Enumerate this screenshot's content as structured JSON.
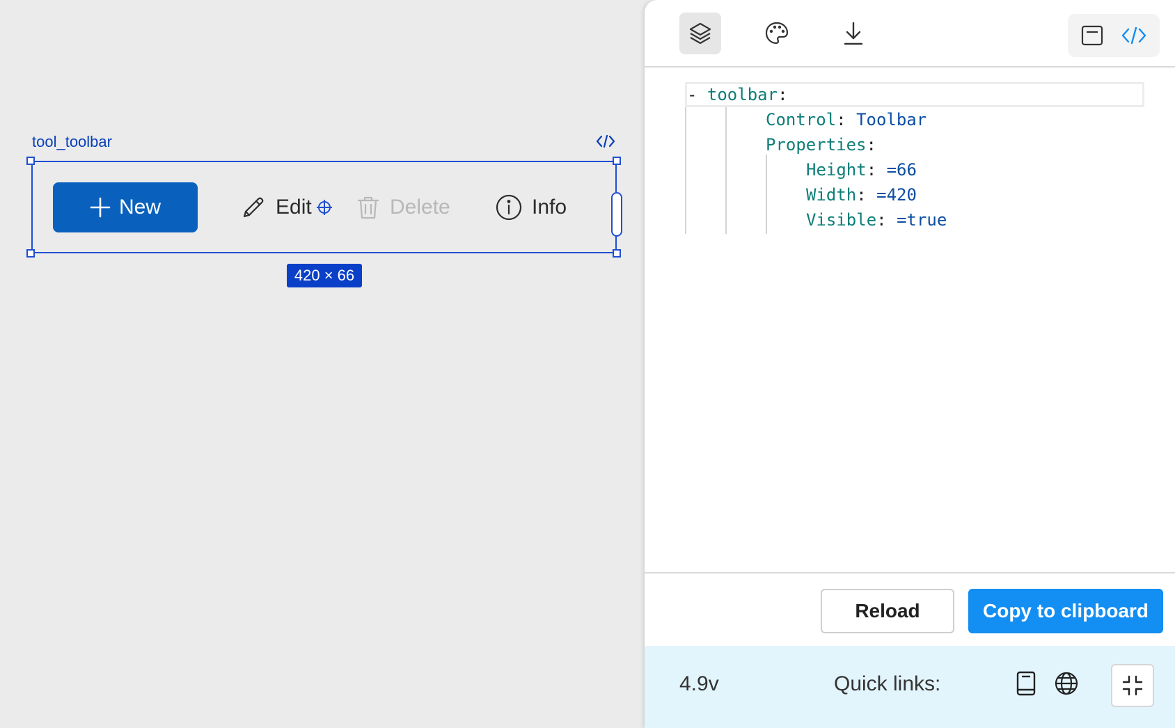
{
  "canvas": {
    "control_name": "tool_toolbar",
    "size_badge": "420 × 66",
    "toolbar": {
      "new_label": "New",
      "edit_label": "Edit",
      "delete_label": "Delete",
      "info_label": "Info"
    }
  },
  "panel": {
    "tabs": [
      "layers-icon",
      "palette-icon",
      "download-icon"
    ],
    "view_toggle": [
      "form-view-icon",
      "code-view-icon"
    ],
    "code": {
      "dash": "-",
      "root_key": "toolbar",
      "colon": ":",
      "control_key": "Control",
      "control_value": "Toolbar",
      "properties_key": "Properties",
      "props": [
        {
          "key": "Height",
          "value": "=66"
        },
        {
          "key": "Width",
          "value": "=420"
        },
        {
          "key": "Visible",
          "value": "=true"
        }
      ]
    },
    "footer": {
      "reload_label": "Reload",
      "copy_label": "Copy to clipboard"
    },
    "status": {
      "version": "4.9v",
      "quick_links_label": "Quick links:"
    }
  },
  "colors": {
    "accent": "#138ef2",
    "primary_button": "#0a61bd",
    "selection": "#1f4fd1",
    "status_bar_bg": "#e3f5fc"
  }
}
